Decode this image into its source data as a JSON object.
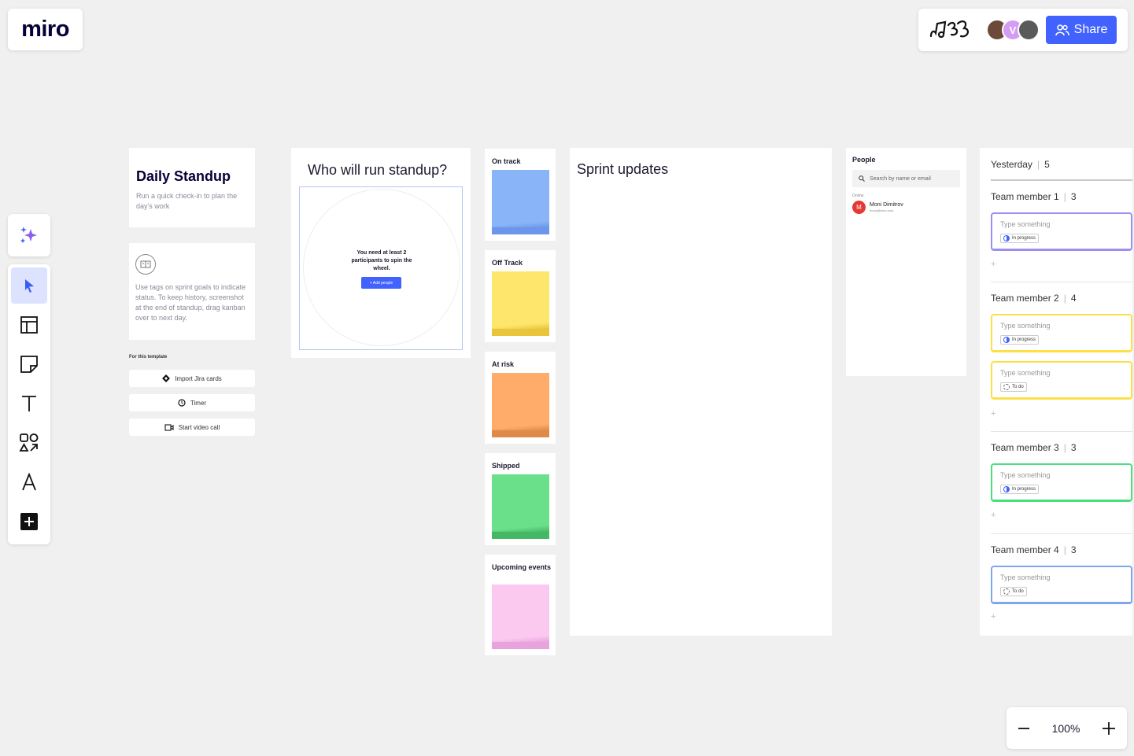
{
  "app": {
    "logo": "miro"
  },
  "header": {
    "avatars": [
      {
        "initial": "",
        "color": "#6b4a3a"
      },
      {
        "initial": "V",
        "color": "#d49cf5"
      },
      {
        "initial": "",
        "color": "#5a5a5a"
      }
    ],
    "share_label": "Share",
    "accent": "#4262ff"
  },
  "zoom": {
    "level": "100%"
  },
  "standup": {
    "title": "Daily Standup",
    "subtitle": "Run a quick check-in to plan the day's work",
    "tip": "Use tags on sprint goals to indicate status. To keep history, screenshot at the end of standup, drag kanban over to next day.",
    "template_label": "For this template",
    "buttons": [
      {
        "label": "Import Jira cards",
        "icon": "jira-icon"
      },
      {
        "label": "Timer",
        "icon": "timer-icon"
      },
      {
        "label": "Start video call",
        "icon": "video-icon"
      }
    ]
  },
  "wheel": {
    "title": "Who will run standup?",
    "message": "You need at least 2 participants to spin the wheel.",
    "button": "+ Add people"
  },
  "statuses": [
    {
      "label": "On track",
      "color": "#8ab4f8",
      "band": "#6b97ea"
    },
    {
      "label": "Off Track",
      "color": "#fde66b",
      "band": "#e8c53a"
    },
    {
      "label": "At risk",
      "color": "#ffac6b",
      "band": "#e08a4a"
    },
    {
      "label": "Shipped",
      "color": "#6be08a",
      "band": "#45b865"
    },
    {
      "label": "Upcoming events",
      "color": "#fbc9f0",
      "band": "#e9a3dc"
    }
  ],
  "sprint": {
    "title": "Sprint updates"
  },
  "people": {
    "title": "People",
    "search_placeholder": "Search by name or email",
    "online_label": "Online",
    "person": {
      "initial": "M",
      "name": "Moni Dimitrov",
      "email": "mony@miro.com"
    }
  },
  "yesterday": {
    "label": "Yesterday",
    "count": "5",
    "members": [
      {
        "name": "Team member 1",
        "count": "3",
        "cards": [
          {
            "placeholder": "Type something",
            "tag": "In progress",
            "color": "#9b8ff0"
          }
        ]
      },
      {
        "name": "Team member 2",
        "count": "4",
        "cards": [
          {
            "placeholder": "Type something",
            "tag": "In progress",
            "color": "#fde047"
          },
          {
            "placeholder": "Type something",
            "tag": "To do",
            "color": "#fde047"
          }
        ]
      },
      {
        "name": "Team member 3",
        "count": "3",
        "cards": [
          {
            "placeholder": "Type something",
            "tag": "In progress",
            "color": "#4ade80"
          }
        ]
      },
      {
        "name": "Team member 4",
        "count": "3",
        "cards": [
          {
            "placeholder": "Type something",
            "tag": "To do",
            "color": "#7ea6ee"
          }
        ]
      }
    ],
    "add_label": "+"
  }
}
